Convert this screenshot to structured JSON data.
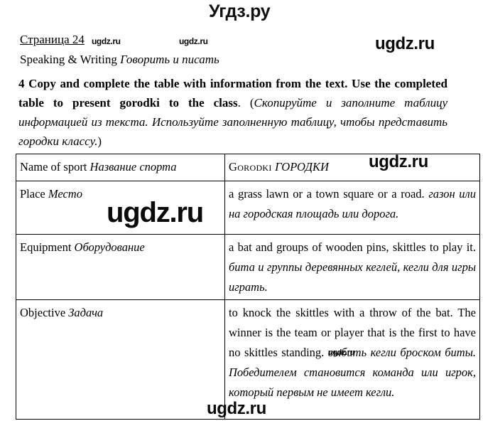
{
  "site": {
    "logo": "Угдз.ру",
    "watermark": "ugdz.ru"
  },
  "page": {
    "page_label": "Страница 24",
    "section_en": "Speaking & Writing ",
    "section_ru": "Говорить и писать"
  },
  "task": {
    "number_and_en_bold": "4 Copy and complete the table with information from the text. Use the completed table to present gorodki to the class",
    "en_tail": ". (",
    "ru_italic": "Скопируйте и заполните таблицу информацией из текста. Используйте заполненную таблицу, чтобы представить городки классу.",
    "close_paren": ")"
  },
  "table": {
    "rows": [
      {
        "label_en": "Name of sport ",
        "label_ru": "Название спорта",
        "value_en": "Gorodki ",
        "value_ru": "ГОРОДКИ"
      },
      {
        "label_en": "Place ",
        "label_ru": "Место",
        "value_en": "a grass lawn or a town square or a road. ",
        "value_ru": "газон или на городская площадь или дорога."
      },
      {
        "label_en": "Equipment ",
        "label_ru": "Оборудование",
        "value_en": "a bat and groups of wooden pins, skittles to play it. ",
        "value_ru": "бита и группы деревянных кеглей, кегли для игры играть."
      },
      {
        "label_en": "Objective ",
        "label_ru": "Задача",
        "value_en": "to knock the skittles with a throw of the bat. The winner is the team or player that is the first to have no skittles standing. ",
        "value_ru": "выбить кегли броском биты. Победителем становится команда или игрок, который первым не имеет кегли."
      }
    ]
  }
}
